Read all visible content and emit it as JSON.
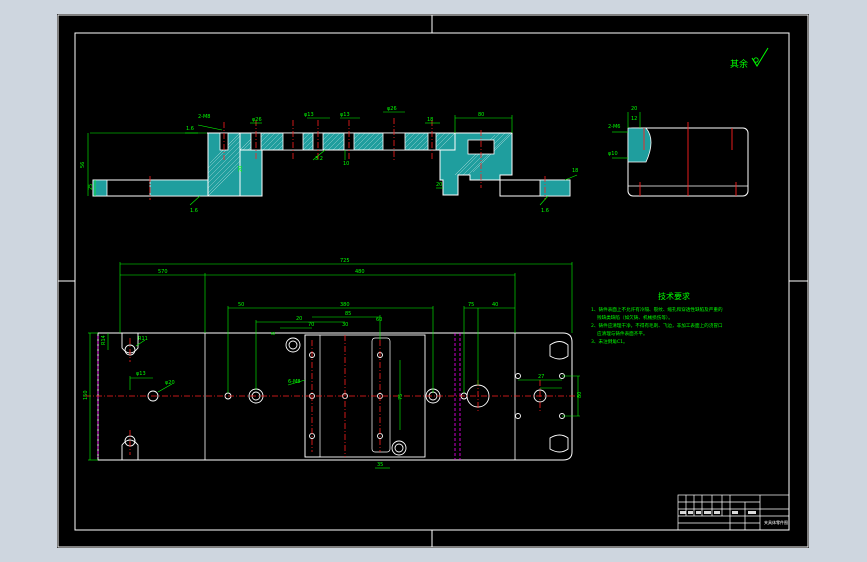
{
  "colors": {
    "viewport_bg": "#ced6df",
    "drawing_bg": "#000000",
    "border": "#ffffff",
    "section_fill": "#1f9e9e",
    "part_outline": "#ffffff",
    "dimension": "#00ff00",
    "centerline": "#ff2020",
    "hidden_line": "#ff00ff",
    "hatch": "#ffffff",
    "annotation_text": "#00ff00"
  },
  "surface_mark": {
    "label": "其余"
  },
  "section_view": {
    "dims": {
      "d_top_left": "2-M8",
      "d_bore_1": "φ26",
      "d_bore_2": "φ13",
      "d_bore_3": "φ13",
      "d_bore_4": "φ26",
      "d_width": "80",
      "d_height_left": "56",
      "d_height_right": "18",
      "d_small_1": "18",
      "d_small_2": "25",
      "d_small_3": "20",
      "d_roughness_1": "1.6",
      "d_roughness_2": "1.6",
      "d_roughness_3": "1.6",
      "d_depth": "10",
      "d_sec_a": "3.2",
      "d_sec_b": "20"
    }
  },
  "side_view": {
    "dims": {
      "d_h1": "20",
      "d_h2": "12",
      "d_thread": "2-M6",
      "d_dia": "φ10"
    }
  },
  "plan_view": {
    "dims": {
      "overall": "725",
      "d_570": "570",
      "d_480": "480",
      "d_50": "50",
      "d_380": "380",
      "d_75": "75",
      "d_40": "40",
      "d_20": "20",
      "d_70": "70",
      "d_85": "85",
      "d_30": "30",
      "d_60": "60",
      "d_75b": "75",
      "d_35": "35",
      "d_8": "8",
      "d_6": "6-M8",
      "d_height": "150",
      "d_r1": "R11",
      "d_r2": "R14",
      "d_r3": "φ20",
      "d_right_1": "27",
      "d_right_2": "80",
      "d_hole": "φ13"
    }
  },
  "tech_requirements": {
    "title": "技术要求",
    "lines": [
      "1、铸件表面上不允许有冷隔、裂纹、缩孔和穿透性缺陷及严重的",
      "残缺类缺陷（如欠铸、机械损伤等）。",
      "2、铸件应清理干净，不得有毛刺、飞边，非加工表面上的浇冒口",
      "应清理与铸件表面齐平。",
      "3、未注倒角C1。"
    ]
  },
  "title_block": {
    "label": "夹具体零件图"
  }
}
